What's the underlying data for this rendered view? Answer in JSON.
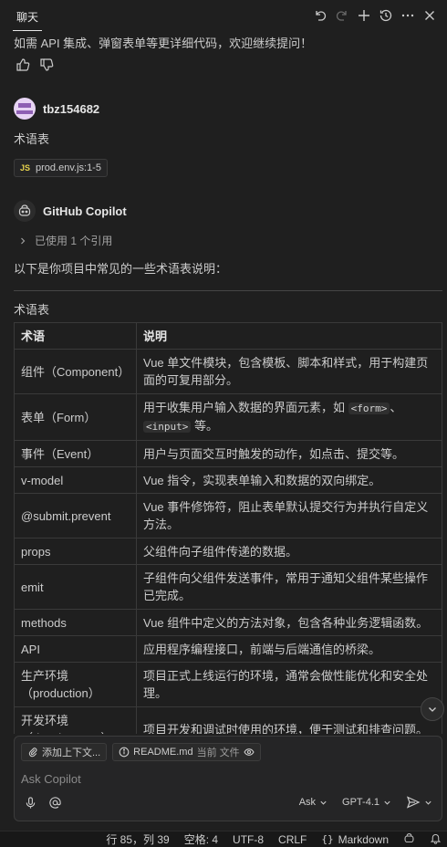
{
  "header": {
    "tab_title": "聊天",
    "icons": [
      "undo-icon",
      "redo-icon",
      "new-chat-icon",
      "history-icon",
      "more-icon",
      "close-icon"
    ]
  },
  "chat": {
    "assistant_tail": "如需 API 集成、弹窗表单等更详细代码，欢迎继续提问！",
    "user": {
      "name": "tbz154682",
      "message": "术语表",
      "attachment": {
        "badge": "JS",
        "label": "prod.env.js:1-5"
      }
    },
    "copilot": {
      "name": "GitHub Copilot",
      "references": "已使用 1 个引用",
      "intro": "以下是你项目中常见的一些术语表说明：",
      "table_heading": "术语表",
      "table": {
        "headers": [
          "术语",
          "说明"
        ],
        "rows": [
          {
            "term": "组件（Component）",
            "desc": "Vue 单文件模块，包含模板、脚本和样式，用于构建页面的可复用部分。"
          },
          {
            "term": "表单（Form）",
            "desc_pre": "用于收集用户输入数据的界面元素，如 ",
            "code1": "<form>",
            "desc_mid": "、",
            "code2": "<input>",
            "desc_post": " 等。"
          },
          {
            "term": "事件（Event）",
            "desc": "用户与页面交互时触发的动作，如点击、提交等。"
          },
          {
            "term": "v-model",
            "desc": "Vue 指令，实现表单输入和数据的双向绑定。"
          },
          {
            "term": "@submit.prevent",
            "desc": "Vue 事件修饰符，阻止表单默认提交行为并执行自定义方法。"
          },
          {
            "term": "props",
            "desc": "父组件向子组件传递的数据。"
          },
          {
            "term": "emit",
            "desc": "子组件向父组件发送事件，常用于通知父组件某些操作已完成。"
          },
          {
            "term": "methods",
            "desc": "Vue 组件中定义的方法对象，包含各种业务逻辑函数。"
          },
          {
            "term": "API",
            "desc": "应用程序编程接口，前端与后端通信的桥梁。"
          },
          {
            "term": "生产环境（production）",
            "desc": "项目正式上线运行的环境，通常会做性能优化和安全处理。"
          },
          {
            "term": "开发环境（development）",
            "desc": "项目开发和调试时使用的环境，便于测试和排查问题。"
          }
        ]
      }
    }
  },
  "input": {
    "add_context": "添加上下文...",
    "readme_chip": "README.md",
    "readme_note": "当前 文件",
    "placeholder": "Ask Copilot",
    "mode": "Ask",
    "model": "GPT-4.1"
  },
  "status_bar": {
    "position": "行 85，列 39",
    "spaces": "空格: 4",
    "encoding": "UTF-8",
    "eol": "CRLF",
    "language": "Markdown"
  },
  "colors": {
    "background": "#1f1f1f",
    "text": "#cccccc",
    "border": "#3a3a3a",
    "js_badge": "#e8d44d"
  }
}
